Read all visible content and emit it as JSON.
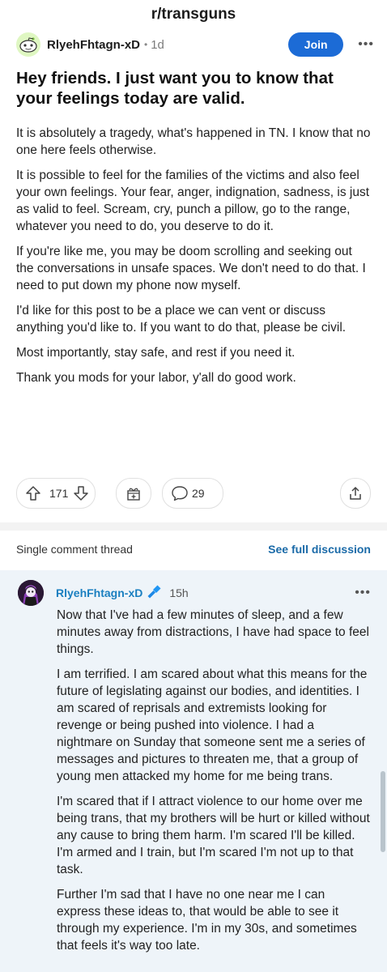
{
  "header": {
    "subreddit": "r/transguns"
  },
  "post": {
    "author": "RlyehFhtagn-xD",
    "separator": "•",
    "age": "1d",
    "join_label": "Join",
    "more": "•••",
    "title": "Hey friends. I just want you to know that your feelings today are valid.",
    "paragraphs": [
      "It is absolutely a tragedy, what's happened in TN. I know that no one here feels otherwise.",
      "It is possible to feel for the families of the victims and also feel your own feelings. Your fear, anger, indignation, sadness, is just as valid to feel. Scream, cry, punch a pillow, go to the range, whatever you need to do, you deserve to do it.",
      "If you're like me, you may be doom scrolling and seeking out the conversations in unsafe spaces. We don't need to do that. I need to put down my phone now myself.",
      "I'd like for this post to be a place we can vent or discuss anything you'd like to. If you want to do that, please be civil.",
      "Most importantly, stay safe, and rest if you need it.",
      "Thank you mods for your labor, y'all do good work."
    ],
    "votes": "171",
    "comments": "29"
  },
  "icons": {
    "upvote": "upvote-arrow-icon",
    "downvote": "downvote-arrow-icon",
    "award": "award-gift-icon",
    "comment": "comment-bubble-icon",
    "share": "share-icon",
    "mic": "microphone-icon"
  },
  "colors": {
    "join": "#1c6bd6",
    "link": "#1a6aa8",
    "comment_bg": "#eef4f9",
    "comment_author": "#1a7fc0"
  },
  "thread": {
    "label": "Single comment thread",
    "see_full": "See full discussion"
  },
  "comment": {
    "author": "RlyehFhtagn-xD",
    "age": "15h",
    "more": "•••",
    "paragraphs": [
      "Now that I've had a few minutes of sleep, and a few minutes away from distractions, I have had space to feel things.",
      "I am terrified. I am scared about what this means for the future of legislating against our bodies, and identities. I am scared of reprisals and extremists looking for revenge or being pushed into violence. I had a nightmare on Sunday that someone sent me a series of messages and pictures to threaten me, that a group of young men attacked my home for me being trans.",
      "I'm scared that if I attract violence to our home over me being trans, that my brothers will be hurt or killed without any cause to bring them harm. I'm scared I'll be killed. I'm armed and I train, but I'm scared I'm not up to that task.",
      "Further I'm sad that I have no one near me I can express these ideas to, that would be able to see it through my experience. I'm in my 30s, and sometimes that feels it's way too late."
    ]
  }
}
